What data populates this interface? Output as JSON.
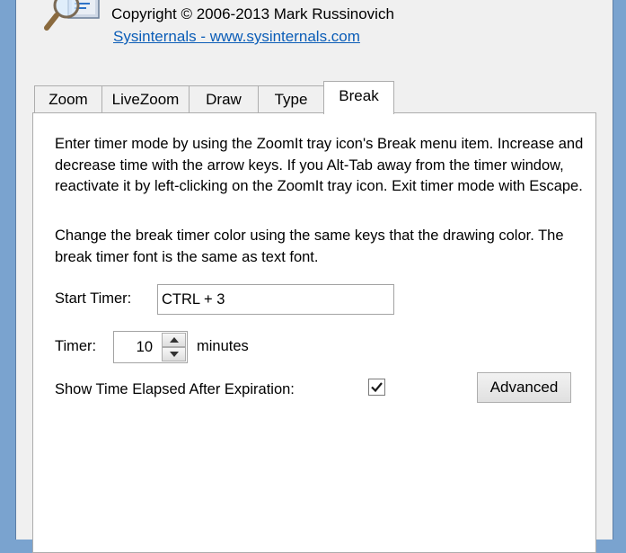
{
  "header": {
    "icon": "zoomit-magnifier-icon",
    "copyright": "Copyright © 2006-2013 Mark Russinovich",
    "link": "Sysinternals - www.sysinternals.com"
  },
  "tabs": [
    "Zoom",
    "LiveZoom",
    "Draw",
    "Type",
    "Break"
  ],
  "active_tab": "Break",
  "panel": {
    "description_1": "Enter timer mode by using the ZoomIt tray icon's Break menu item. Increase and decrease time with the arrow keys. If you Alt-Tab away from the timer window, reactivate it by left-clicking on the ZoomIt tray icon. Exit timer mode with Escape.",
    "description_2": "Change the break timer color using the same keys that the drawing color. The break timer font is the same as text font.",
    "start_timer_label": "Start Timer:",
    "start_timer_value": "CTRL + 3",
    "timer_label": "Timer:",
    "timer_value": "10",
    "timer_unit": "minutes",
    "show_elapsed_label": "Show Time Elapsed After Expiration:",
    "show_elapsed_checked": true,
    "advanced_button": "Advanced"
  },
  "colors": {
    "link": "#0b5db7",
    "dialog_background": "#f0f0f0",
    "panel_background": "#ffffff"
  }
}
